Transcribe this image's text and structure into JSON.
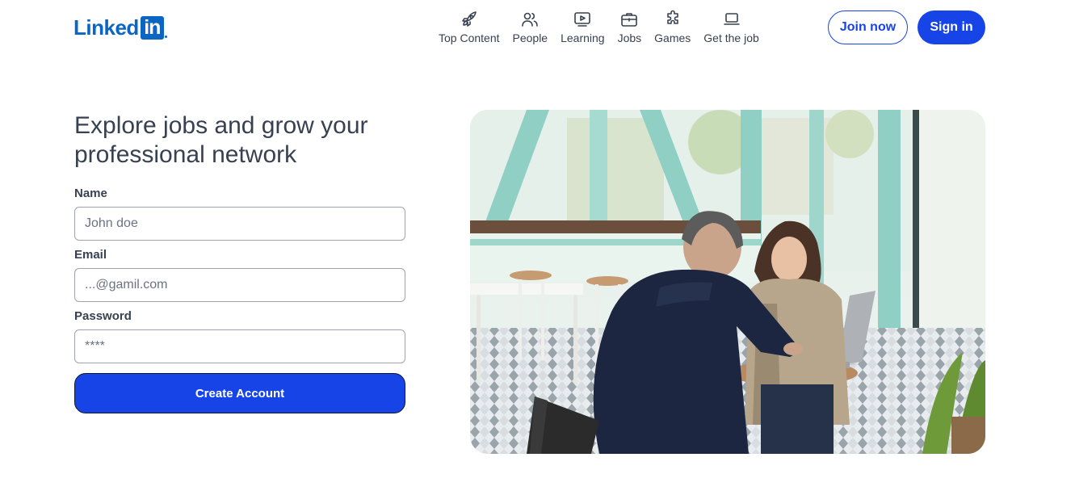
{
  "header": {
    "logo": {
      "text": "Linked",
      "box_text": "in"
    },
    "nav": [
      {
        "label": "Top Content",
        "icon": "rocket-icon"
      },
      {
        "label": "People",
        "icon": "people-icon"
      },
      {
        "label": "Learning",
        "icon": "play-screen-icon"
      },
      {
        "label": "Jobs",
        "icon": "briefcase-icon"
      },
      {
        "label": "Games",
        "icon": "puzzle-icon"
      },
      {
        "label": "Get the job",
        "icon": "laptop-icon"
      }
    ],
    "join_label": "Join now",
    "signin_label": "Sign in"
  },
  "main": {
    "headline": "Explore jobs and grow your professional network",
    "form": {
      "name_label": "Name",
      "name_placeholder": "John doe",
      "email_label": "Email",
      "email_placeholder": "...@gamil.com",
      "password_label": "Password",
      "password_placeholder": "****",
      "submit_label": "Create Account"
    },
    "hero_image": "photo of two people working at a laptop in a cafe"
  },
  "colors": {
    "brand": "#0a66c2",
    "accent": "#1744e6",
    "text": "#374151"
  }
}
